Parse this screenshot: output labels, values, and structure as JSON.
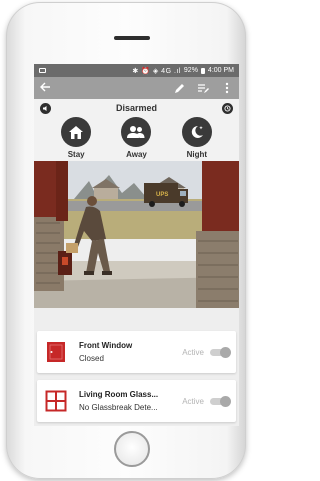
{
  "status_bar": {
    "icons": "✱ ⏰ ◈ 4G .ıl",
    "battery": "92%",
    "time": "4:00 PM"
  },
  "toolbar": {
    "back_icon": "arrow-back-icon",
    "actions": [
      "pencil-icon",
      "edit-list-icon",
      "more-vert-icon"
    ]
  },
  "mode": {
    "status_text": "Disarmed",
    "left_icon": "speaker-icon",
    "right_icon": "clock-icon"
  },
  "arm_buttons": [
    {
      "label": "Stay",
      "icon": "house-icon"
    },
    {
      "label": "Away",
      "icon": "people-icon"
    },
    {
      "label": "Night",
      "icon": "moon-stars-icon"
    }
  ],
  "camera": {
    "description_icon": "camera-feed",
    "truck_text": "UPS"
  },
  "devices": [
    {
      "name": "Front Window",
      "status": "Closed",
      "state": "Active",
      "icon": "window-icon",
      "accent": "#c62828"
    },
    {
      "name": "Living Room Glass...",
      "status": "No Glassbreak Dete...",
      "state": "Active",
      "icon": "glass-panel-icon",
      "accent": "#c62828"
    }
  ],
  "colors": {
    "status_bar": "#6b6b6b",
    "toolbar": "#9e9e9e",
    "button_dark": "#3a3a3a",
    "accent_red": "#c62828"
  }
}
